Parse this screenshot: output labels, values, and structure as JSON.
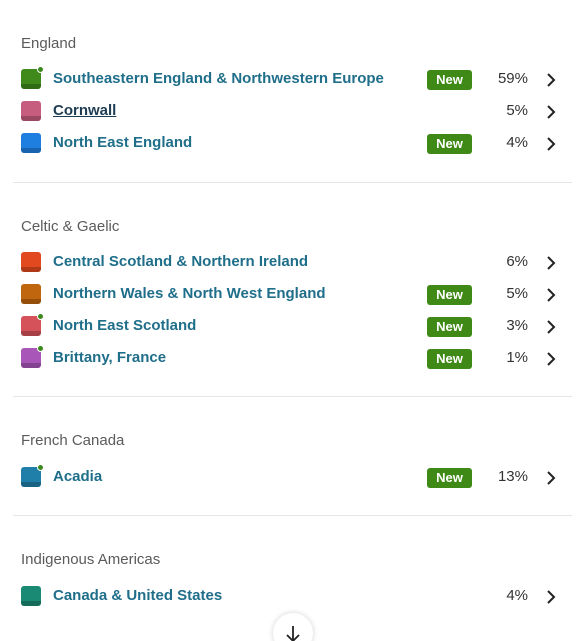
{
  "sections": [
    {
      "title": "England",
      "regions": [
        {
          "name": "Southeastern England & Northwestern Europe",
          "percent": "59%",
          "badge": "New",
          "color": "#3f8a1a",
          "dot": true
        },
        {
          "name": "Cornwall",
          "percent": "5%",
          "badge": "",
          "color": "#c65c7e",
          "dot": false
        },
        {
          "name": "North East England",
          "percent": "4%",
          "badge": "New",
          "color": "#1f7fe0",
          "dot": false
        }
      ]
    },
    {
      "title": "Celtic & Gaelic",
      "regions": [
        {
          "name": "Central Scotland & Northern Ireland",
          "percent": "6%",
          "badge": "",
          "color": "#e2491e",
          "dot": false
        },
        {
          "name": "Northern Wales & North West England",
          "percent": "5%",
          "badge": "New",
          "color": "#c0660e",
          "dot": false
        },
        {
          "name": "North East Scotland",
          "percent": "3%",
          "badge": "New",
          "color": "#d6525a",
          "dot": true
        },
        {
          "name": "Brittany, France",
          "percent": "1%",
          "badge": "New",
          "color": "#a956b9",
          "dot": true
        }
      ]
    },
    {
      "title": "French Canada",
      "regions": [
        {
          "name": "Acadia",
          "percent": "13%",
          "badge": "New",
          "color": "#1f7fa8",
          "dot": true
        }
      ]
    },
    {
      "title": "Indigenous Americas",
      "regions": [
        {
          "name": "Canada & United States",
          "percent": "4%",
          "badge": "",
          "color": "#1a8a74",
          "dot": false
        }
      ]
    }
  ],
  "icons": {
    "row_action": "chevron-right-icon",
    "scroll": "arrow-down-icon",
    "new_indicator": "green-dot-icon"
  },
  "colors": {
    "link": "#1f6e8a",
    "badge_bg": "#3f8a16",
    "indicator_dot": "#3c8a1e"
  }
}
